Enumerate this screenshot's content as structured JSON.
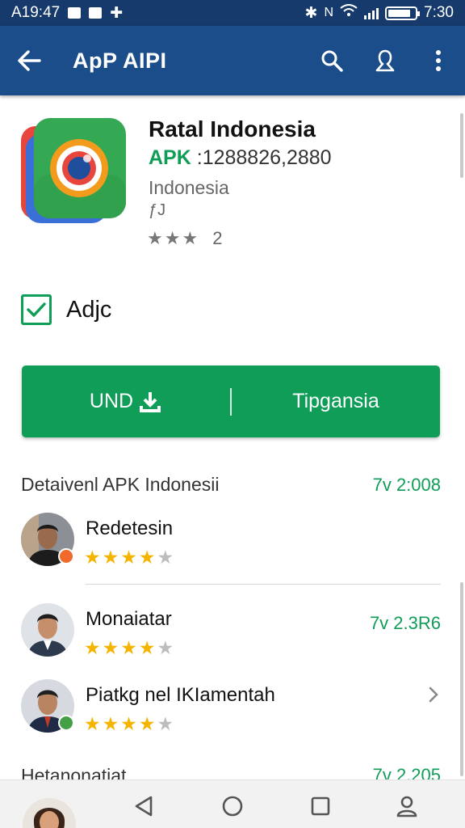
{
  "status_bar": {
    "time_left": "A19:47",
    "icons_left": [
      "mail-icon",
      "message-icon",
      "plus-icon"
    ],
    "icons_right": [
      "bluetooth-icon",
      "nfc-icon",
      "wifi-icon",
      "signal-icon",
      "battery-icon"
    ],
    "time_right": "7:30"
  },
  "app_bar": {
    "title": "ApP AIPI",
    "back_icon": "arrow-left-icon",
    "action_icons": [
      "search-icon",
      "account-icon",
      "more-vert-icon"
    ]
  },
  "app": {
    "name": "Ratal Indonesia",
    "apk_label": "APK",
    "apk_value": " :1288826,2880",
    "country": "Indonesia",
    "small_icon_label": "ƒJ",
    "rating_count": "2",
    "rating": 3
  },
  "checkbox": {
    "label": "Adjc",
    "checked": true
  },
  "buttons": {
    "left": "UND",
    "right": "Tipgansia"
  },
  "details": {
    "title": "Detaivenl APK Indonesii",
    "date": "7v 2:008"
  },
  "reviews": [
    {
      "name": "Redetesin",
      "stars": 4,
      "date": ""
    },
    {
      "name": "Monaiatar",
      "stars": 4,
      "date": "7v 2.3R6"
    },
    {
      "name": "Piatkg nel IKIamentah",
      "stars": 4,
      "date": ""
    }
  ],
  "partial_row": {
    "name": "Hetanonatiat",
    "date": "7v 2.205"
  },
  "nav_bar": {
    "icons": [
      "back-triangle-icon",
      "home-circle-icon",
      "recents-square-icon",
      "person-icon"
    ]
  },
  "colors": {
    "primary": "#1b4d8a",
    "status_bar": "#163a6b",
    "accent": "#0f9d58",
    "star": "#f4b400"
  }
}
